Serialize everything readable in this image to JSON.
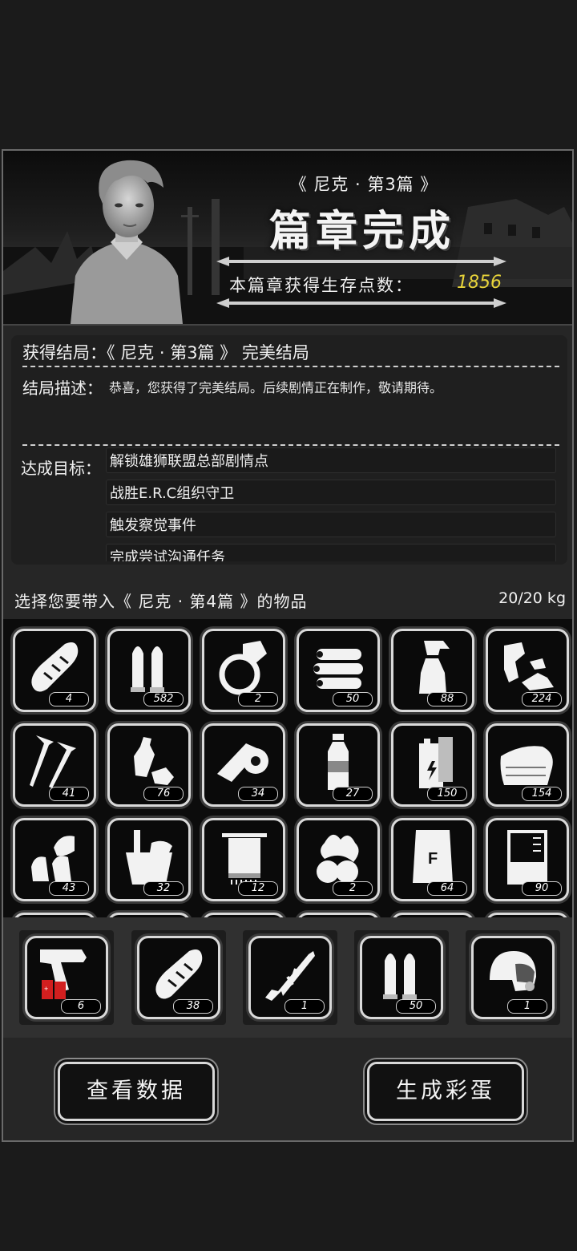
{
  "header": {
    "chapter_subtitle": "《 尼克 · 第3篇 》",
    "chapter_title": "篇章完成",
    "points_label": "本篇章获得生存点数：",
    "points_value": "1856"
  },
  "ending": {
    "title": "获得结局：《 尼克 · 第3篇 》 完美结局",
    "description_label": "结局描述：",
    "description": "恭喜，您获得了完美结局。后续剧情正在制作，敬请期待。",
    "goals_label": "达成目标：",
    "goals": [
      "解锁雄狮联盟总部剧情点",
      "战胜E.R.C组织守卫",
      "触发察觉事件",
      "完成尝试沟通任务"
    ]
  },
  "item_select": {
    "prompt": "选择您要带入《 尼克 · 第4篇 》的物品",
    "weight": "20/20 kg"
  },
  "inventory": [
    {
      "icon": "bread-icon",
      "count": "4"
    },
    {
      "icon": "bullets-icon",
      "count": "582"
    },
    {
      "icon": "ring-icon",
      "count": "2"
    },
    {
      "icon": "logs-icon",
      "count": "50"
    },
    {
      "icon": "spray-bottle-icon",
      "count": "88"
    },
    {
      "icon": "scrap-icon",
      "count": "224"
    },
    {
      "icon": "screws-icon",
      "count": "41"
    },
    {
      "icon": "plastic-bottles-icon",
      "count": "76"
    },
    {
      "icon": "cloth-roll-icon",
      "count": "34"
    },
    {
      "icon": "water-bottle-icon",
      "count": "27"
    },
    {
      "icon": "battery-icon",
      "count": "150"
    },
    {
      "icon": "fabric-icon",
      "count": "154"
    },
    {
      "icon": "bullet-casings-icon",
      "count": "43"
    },
    {
      "icon": "bucket-icon",
      "count": "32"
    },
    {
      "icon": "towel-icon",
      "count": "12"
    },
    {
      "icon": "vegetable-icon",
      "count": "2"
    },
    {
      "icon": "flour-sack-icon",
      "count": "64"
    },
    {
      "icon": "beaker-icon",
      "count": "90"
    }
  ],
  "selected_items": [
    {
      "icon": "flare-gun-icon",
      "count": "6"
    },
    {
      "icon": "bread-icon",
      "count": "38"
    },
    {
      "icon": "rifle-icon",
      "count": "1"
    },
    {
      "icon": "bullets-icon",
      "count": "50"
    },
    {
      "icon": "helmet-icon",
      "count": "1"
    }
  ],
  "buttons": {
    "view_data": "查看数据",
    "generate_egg": "生成彩蛋"
  },
  "colors": {
    "points": "#e8d43a",
    "flare_red": "#d21f1f"
  }
}
